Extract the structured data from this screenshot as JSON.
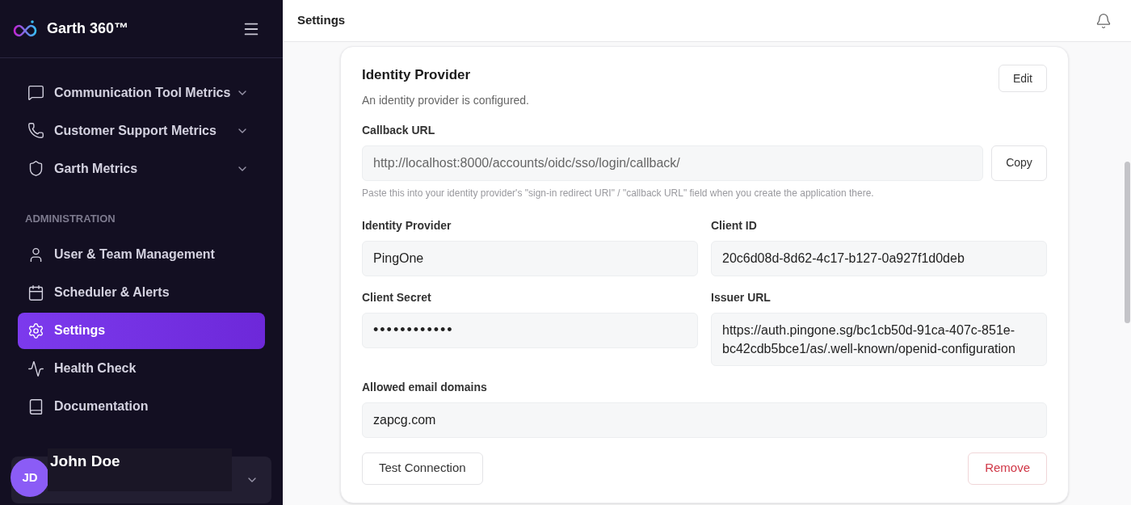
{
  "brand": {
    "name": "Garth 360™"
  },
  "sidebar": {
    "items": [
      {
        "label": "Communication Tool Metrics",
        "expandable": true,
        "selected": false
      },
      {
        "label": "Customer Support Metrics",
        "expandable": true,
        "selected": false
      },
      {
        "label": "Garth Metrics",
        "expandable": true,
        "selected": false
      }
    ],
    "section": "ADMINISTRATION",
    "admin_items": [
      {
        "label": "User & Team Management",
        "expandable": false,
        "selected": false
      },
      {
        "label": "Scheduler & Alerts",
        "expandable": false,
        "selected": false
      },
      {
        "label": "Settings",
        "expandable": false,
        "selected": true
      },
      {
        "label": "Health Check",
        "expandable": false,
        "selected": false
      },
      {
        "label": "Documentation",
        "expandable": false,
        "selected": false
      }
    ],
    "user": {
      "initials": "JD",
      "name": "John Doe"
    }
  },
  "header": {
    "title": "Settings"
  },
  "card": {
    "title": "Identity Provider",
    "subtitle": "An identity provider is configured.",
    "edit_button": "Edit",
    "callback": {
      "label": "Callback URL",
      "value": "http://localhost:8000/accounts/oidc/sso/login/callback/",
      "button": "Copy",
      "hint": "Paste this into your identity provider's \"sign-in redirect URI\" / \"callback URL\" field when you create the application there."
    },
    "fields": [
      {
        "label": "Identity Provider",
        "value": "PingOne",
        "kind": "text"
      },
      {
        "label": "Client ID",
        "value": "20c6d08d-8d62-4c17-b127-0a927f1d0deb",
        "kind": "text"
      },
      {
        "label": "Client Secret",
        "value": "••••••••••••",
        "kind": "secret"
      },
      {
        "label": "Issuer URL",
        "value": "https://auth.pingone.sg/bc1cb50d-91ca-407c-851e-bc42cdb5bce1/as/.well-known/openid-configuration",
        "kind": "text"
      }
    ],
    "domains": {
      "label": "Allowed email domains",
      "value": "zapcg.com"
    },
    "test_button": "Test Connection",
    "remove_button": "Remove"
  }
}
